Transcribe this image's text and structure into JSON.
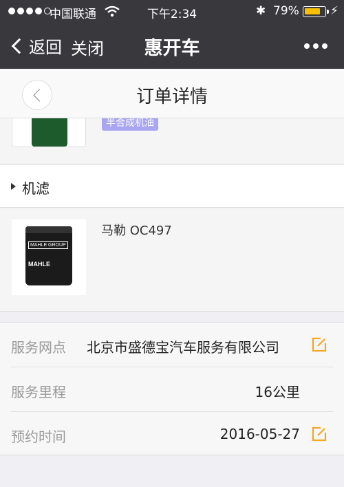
{
  "status_bar": {
    "carrier": "中国联通",
    "time": "下午2:34",
    "battery_percent": "79%",
    "battery_level": 0.79
  },
  "nav": {
    "back_label": "返回",
    "close_label": "关闭",
    "title": "惠开车"
  },
  "page": {
    "title": "订单详情"
  },
  "product_top": {
    "tag": "半合成机油"
  },
  "section": {
    "label": "机滤"
  },
  "filter": {
    "name": "马勒 OC497",
    "brand_text": "MAHLE GROUP",
    "logo_text": "MAHLE"
  },
  "info": {
    "rows": [
      {
        "label": "服务网点",
        "value": "北京市盛德宝汽车服务有限公司",
        "editable": true
      },
      {
        "label": "服务里程",
        "value": "16公里",
        "editable": false
      },
      {
        "label": "预约时间",
        "value": "2016-05-27",
        "editable": true
      }
    ]
  },
  "colors": {
    "nav_bg": "#38383d",
    "accent_orange": "#f5a623",
    "tag_purple": "#a9a5f1"
  }
}
